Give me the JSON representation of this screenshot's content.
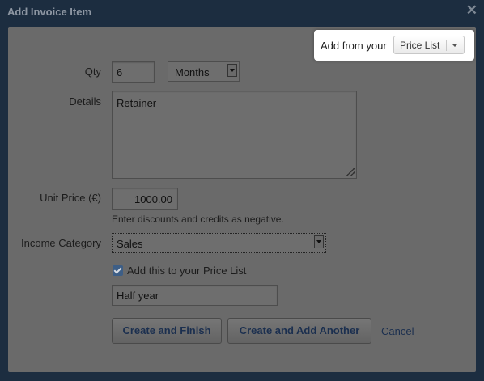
{
  "dialog": {
    "title": "Add Invoice Item",
    "close_symbol": "✕"
  },
  "price_list": {
    "label": "Add from your",
    "button_label": "Price List"
  },
  "form": {
    "qty_label": "Qty",
    "qty_value": "6",
    "unit_select_value": "Months",
    "details_label": "Details",
    "details_value": "Retainer",
    "unit_price_label": "Unit Price (€)",
    "unit_price_value": "1000.00",
    "hint_text": "Enter discounts and credits as negative.",
    "income_category_label": "Income Category",
    "income_category_value": "Sales",
    "add_to_price_list_label": "Add this to your Price List",
    "add_to_price_list_checked": true,
    "price_list_name_value": "Half year"
  },
  "actions": {
    "create_finish": "Create and Finish",
    "create_add_another": "Create and Add Another",
    "cancel": "Cancel"
  },
  "colors": {
    "backdrop": "#1c2d40",
    "dimmed_panel": "#6a6a6a",
    "button_text": "#1b2f4f"
  },
  "icons": {
    "close": "close-icon",
    "dropdown": "chevron-down-icon",
    "resize": "resize-grip-icon",
    "check": "check-icon"
  }
}
